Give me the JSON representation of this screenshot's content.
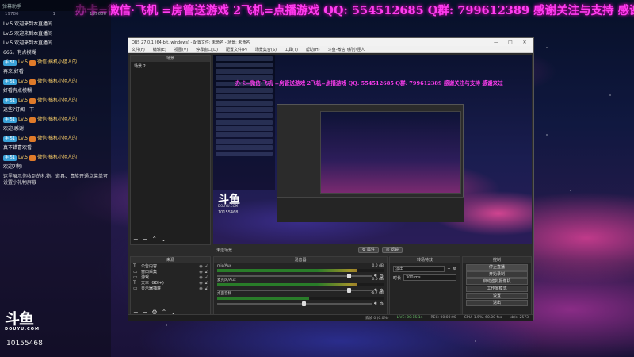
{
  "banner": {
    "text": "办卡=微信·飞机 =房管送游戏 2飞机=点播游戏 QQ: 554512685 Q群: 799612389 感谢关注与支持 感谢来过"
  },
  "chat": {
    "header": "弹幕助手",
    "stats": [
      "19786",
      "1",
      "189686"
    ],
    "messages": [
      {
        "user": "Lv.5",
        "tag": "",
        "text": "欢迎来到本直播间",
        "gift": false
      },
      {
        "user": "Lv.5",
        "tag": "",
        "text": "欢迎来到本直播间",
        "gift": false
      },
      {
        "user": "Lv.5",
        "tag": "",
        "text": "欢迎来到本直播间",
        "gift": false
      },
      {
        "user": "666。有点模糊",
        "tag": "",
        "text": "",
        "gift": false
      },
      {
        "user": "Lv.5",
        "tag": "手 51",
        "text": "微信·搞机小怪人的",
        "gift": true
      },
      {
        "user": "再来,好看",
        "tag": "",
        "text": "",
        "gift": false
      },
      {
        "user": "Lv.5",
        "tag": "手 51",
        "text": "微信·搞机小怪人的",
        "gift": true
      },
      {
        "user": "好看有点模糊",
        "tag": "",
        "text": "",
        "gift": false
      },
      {
        "user": "Lv.5",
        "tag": "手 51",
        "text": "微信·搞机小怪人的",
        "gift": true
      },
      {
        "user": "这些?订阅一下",
        "tag": "",
        "text": "",
        "gift": false
      },
      {
        "user": "Lv.5",
        "tag": "手 51",
        "text": "微信·搞机小怪人的",
        "gift": true
      },
      {
        "user": "欢迎,感谢",
        "tag": "",
        "text": "",
        "gift": false
      },
      {
        "user": "Lv.5",
        "tag": "手 51",
        "text": "微信·搞机小怪人的",
        "gift": true
      },
      {
        "user": "真不错喜欢看",
        "tag": "",
        "text": "",
        "gift": false
      },
      {
        "user": "Lv.5",
        "tag": "手 51",
        "text": "微信·搞机小怪人的",
        "gift": true
      },
      {
        "user": "欢迎7啊!",
        "tag": "",
        "text": "",
        "gift": false
      }
    ],
    "note": "这里展示你收到的礼物、道具、贵族开通点菜单可设置小礼物屏蔽"
  },
  "logo": {
    "mark": "斗鱼",
    "sub": "DOUYU.COM",
    "room_id": "10155468"
  },
  "obs": {
    "title": "OBS 27.0.1 (64-bit, windows) - 配置文件: 未命名 - 场景: 未命名",
    "menu": [
      "文件(F)",
      "编辑(E)",
      "视图(V)",
      "停靠窗口(D)",
      "配置文件(P)",
      "场景集合(S)",
      "工具(T)",
      "帮助(H)",
      "斗鱼-微信飞机小怪人"
    ],
    "scenes_title": "场景",
    "scenes": [
      "场景 2"
    ],
    "preview_banner": "办卡=微信·飞机 =房管送游戏 2飞机=点播游戏 QQ: 554512685 Q群: 799612389 感谢关注与支持 感谢来过",
    "preview_room_id": "10155468",
    "transition_bar": {
      "left": "未选场景",
      "btn1": "属性",
      "btn2": "滤镜"
    },
    "docks": {
      "scenes_bottom_label": "来源",
      "sources_title": "来源",
      "mixer_title": "混音器",
      "transitions_title": "转场特效",
      "controls_title": "控制"
    },
    "sources": [
      {
        "glyph": "T",
        "name": "公告内容"
      },
      {
        "glyph": "▭",
        "name": "窗口采集"
      },
      {
        "glyph": "▭",
        "name": "游戏"
      },
      {
        "glyph": "T",
        "name": "文本 (GDI+)"
      },
      {
        "glyph": "▭",
        "name": "显示器捕获"
      }
    ],
    "mixer": [
      {
        "name": "mic/Aux",
        "db": "0.0 dB",
        "level": 0.84
      },
      {
        "name": "麦克风/Aux",
        "db": "0.0 dB",
        "level": 0.84
      },
      {
        "name": "桌面音频",
        "db": "-6.7 dB",
        "level": 0.55
      }
    ],
    "transition_fields": [
      {
        "label": "",
        "value": "淡出"
      },
      {
        "label": "时长",
        "value": "300 ms"
      }
    ],
    "controls": [
      "停止直播",
      "开始录制",
      "启动虚拟摄像机",
      "工作室模式",
      "设置",
      "退出"
    ],
    "status": {
      "dropped": "丢帧 0 (0.0%)",
      "live": "LIVE: 00:15:14",
      "rec": "REC: 00:00:00",
      "cpu": "CPU: 1.5%, 60.00 fps",
      "kbps": "kb/s: 2573"
    }
  }
}
